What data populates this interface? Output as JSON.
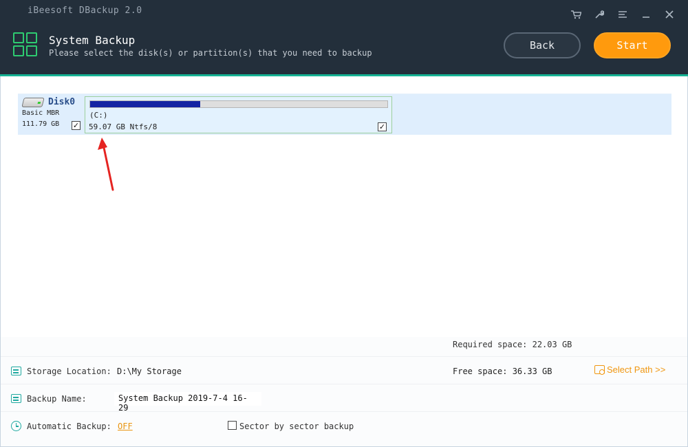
{
  "window": {
    "app_title": "iBeesoft DBackup 2.0",
    "controls": [
      "cart-icon",
      "wrench-icon",
      "menu-icon",
      "minimize-icon",
      "close-icon"
    ]
  },
  "header": {
    "title": "System Backup",
    "subtitle": "Please select the disk(s) or partition(s) that you need to backup",
    "back_label": "Back",
    "start_label": "Start"
  },
  "disk": {
    "name": "Disk0",
    "type": "Basic MBR",
    "size": "111.79 GB",
    "checked": true,
    "partition": {
      "label": "(C:)",
      "info": "59.07 GB Ntfs/8",
      "usage_fraction": 0.37,
      "checked": true
    }
  },
  "summary": {
    "required_space": "Required space: 22.03 GB",
    "storage_label": "Storage Location:",
    "storage_value": "D:\\My Storage",
    "free_space": "Free space: 36.33 GB",
    "select_path": "Select Path >>",
    "backup_name_label": "Backup Name:",
    "backup_name_value": "System Backup 2019-7-4 16-29",
    "auto_backup_label": "Automatic Backup:",
    "auto_backup_value": "OFF",
    "sector_label": "Sector by sector backup",
    "sector_checked": false
  },
  "colors": {
    "header_bg": "#232f3b",
    "accent_line": "#16b394",
    "start_orange": "#ff9a0d",
    "usage_fill": "#1424a3",
    "link_orange": "#f0960f"
  }
}
